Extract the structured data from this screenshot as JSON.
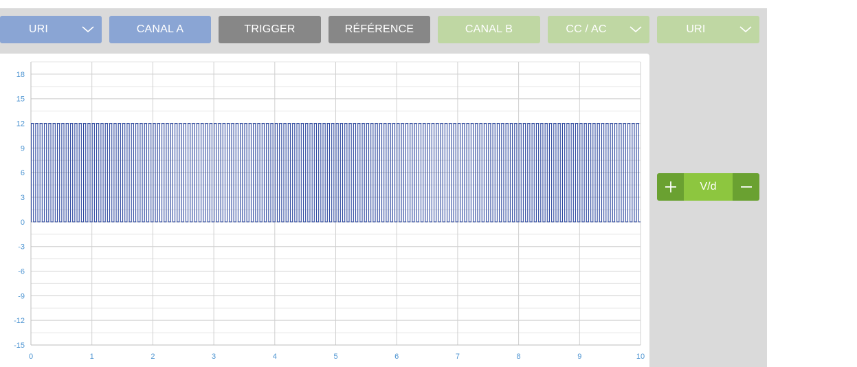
{
  "toolbar": {
    "ch_a_probe": {
      "label": "URI"
    },
    "ch_a": {
      "label": "CANAL A"
    },
    "trigger": {
      "label": "TRIGGER"
    },
    "reference": {
      "label": "RÉFÉRENCE"
    },
    "ch_b": {
      "label": "CANAL B"
    },
    "coupling_b": {
      "label": "CC / AC"
    },
    "ch_b_probe": {
      "label": "URI"
    }
  },
  "colors": {
    "channel_a": "#8aa5d4",
    "neutral": "#878787",
    "channel_b": "#bfd7a3",
    "trace": "#2f4aa0",
    "control_dark": "#6aa131",
    "control_light": "#8dc63f",
    "axis_text": "#4b93d1"
  },
  "volt_div": {
    "label": "V/d",
    "plus_icon": "plus-icon",
    "minus_icon": "minus-icon"
  },
  "chart_data": {
    "type": "line",
    "xlim": [
      0,
      10
    ],
    "ylim": [
      -15,
      19.5
    ],
    "x_ticks": [
      "0",
      "1",
      "2",
      "3",
      "4",
      "5",
      "6",
      "7",
      "8",
      "9",
      "10"
    ],
    "y_ticks": [
      "18",
      "15",
      "12",
      "9",
      "6",
      "3",
      "0",
      "-3",
      "-6",
      "-9",
      "-12",
      "-15"
    ],
    "grid": true,
    "series": [
      {
        "waveform": "square",
        "high": 12,
        "low": 0,
        "cycles": 140,
        "duty": 0.5
      }
    ]
  }
}
